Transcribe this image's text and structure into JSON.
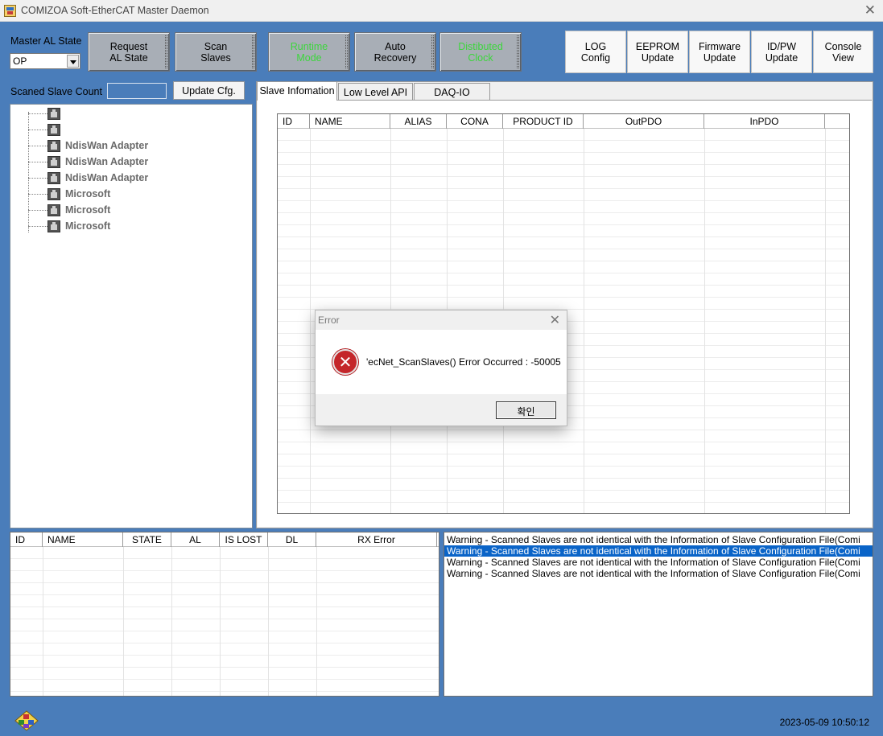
{
  "window": {
    "title": "COMIZOA Soft-EtherCAT Master Daemon",
    "close_glyph": "✕"
  },
  "master_al": {
    "label": "Master AL State",
    "value": "OP"
  },
  "toolbar": [
    {
      "line1": "Request",
      "line2": "AL State"
    },
    {
      "line1": "Scan",
      "line2": "Slaves"
    },
    {
      "line1": "Runtime",
      "line2": "Mode"
    },
    {
      "line1": "Auto",
      "line2": "Recovery"
    },
    {
      "line1": "Distibuted",
      "line2": "Clock"
    }
  ],
  "right_toolbar": [
    {
      "line1": "LOG",
      "line2": "Config"
    },
    {
      "line1": "EEPROM",
      "line2": "Update"
    },
    {
      "line1": "Firmware",
      "line2": "Update"
    },
    {
      "line1": "ID/PW",
      "line2": "Update"
    },
    {
      "line1": "Console",
      "line2": "View"
    }
  ],
  "scan": {
    "label": "Scaned Slave Count",
    "value": "",
    "update_button": "Update Cfg."
  },
  "tree_items": [
    "",
    "",
    "NdisWan Adapter",
    "NdisWan Adapter",
    "NdisWan Adapter",
    "Microsoft",
    "Microsoft",
    "Microsoft"
  ],
  "tabs": [
    "Slave Infomation",
    "Low Level API",
    "DAQ-IO"
  ],
  "slave_table": {
    "columns": [
      "ID",
      "NAME",
      "ALIAS",
      "CONA",
      "PRODUCT ID",
      "OutPDO",
      "InPDO"
    ]
  },
  "status_table": {
    "columns": [
      "ID",
      "NAME",
      "STATE",
      "AL",
      "IS LOST",
      "DL",
      "RX Error"
    ]
  },
  "log": [
    "Warning - Scanned Slaves are not identical with the Information of Slave Configuration File(Comi",
    "Warning - Scanned Slaves are not identical with the Information of Slave Configuration File(Comi",
    "Warning - Scanned Slaves are not identical with the Information of Slave Configuration File(Comi",
    "Warning - Scanned Slaves are not identical with the Information of Slave Configuration File(Comi"
  ],
  "footer": {
    "datetime": "2023-05-09 10:50:12"
  },
  "dialog": {
    "title": "Error",
    "close_glyph": "✕",
    "icon_glyph": "✕",
    "message": "'ecNet_ScanSlaves() Error Occurred : -50005",
    "ok_label": "확인"
  },
  "colors": {
    "window_bg": "#4a7dba",
    "selection": "#0a64c8",
    "green_text": "#3cd63c",
    "error_red": "#c4262a"
  }
}
